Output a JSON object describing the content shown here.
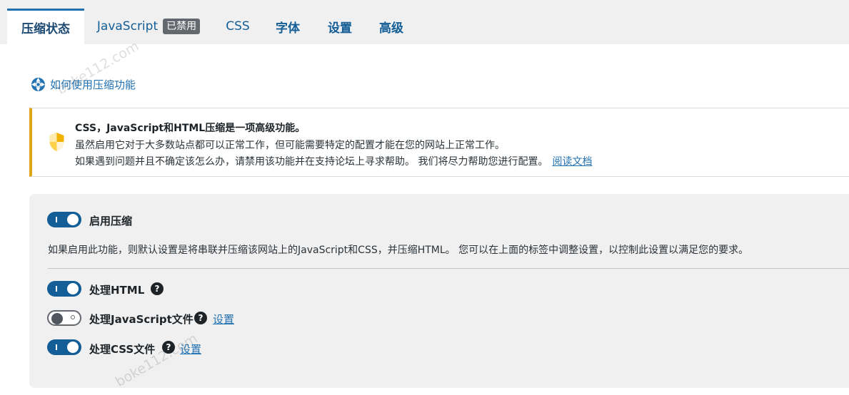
{
  "tabs": {
    "compression": "压缩状态",
    "javascript": "JavaScript",
    "javascript_badge": "已禁用",
    "css": "CSS",
    "fonts": "字体",
    "settings": "设置",
    "advanced": "高级"
  },
  "help_link": {
    "label": "如何使用压缩功能",
    "icon": "lifebuoy-icon"
  },
  "notice": {
    "icon": "shield-warning-icon",
    "title": "CSS，JavaScript和HTML压缩是一项高级功能。",
    "line1": "虽然启用它对于大多数站点都可以正常工作，但可能需要特定的配置才能在您的网站上正常工作。",
    "line2": "如果遇到问题并且不确定该怎么办，请禁用该功能并在支持论坛上寻求帮助。 我们将尽力帮助您进行配置。",
    "docs_link": "阅读文档"
  },
  "settings": {
    "enable_compression": {
      "label": "启用压缩",
      "enabled": true
    },
    "description": "如果启用此功能，则默认设置是将串联并压缩该网站上的JavaScript和CSS，并压缩HTML。 您可以在上面的标签中调整设置，以控制此设置以满足您的要求。",
    "options": [
      {
        "label": "处理HTML",
        "enabled": true,
        "help": "?"
      },
      {
        "label": "处理JavaScript文件",
        "enabled": false,
        "help": "?",
        "link": "设置"
      },
      {
        "label": "处理CSS文件",
        "enabled": true,
        "help": "?",
        "link": "设置"
      }
    ]
  },
  "watermark": "boke112.com",
  "colors": {
    "accent": "#2271b1",
    "toggle_on": "#135e96",
    "notice_border": "#dba617"
  }
}
